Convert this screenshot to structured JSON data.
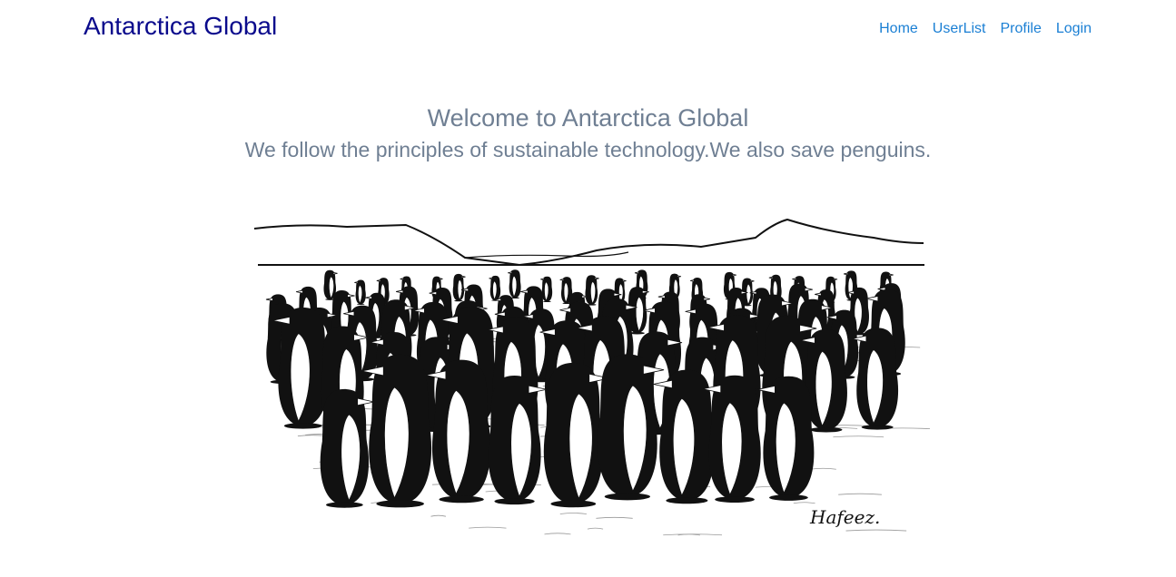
{
  "navbar": {
    "brand": "Antarctica Global",
    "links": [
      {
        "label": "Home"
      },
      {
        "label": "UserList"
      },
      {
        "label": "Profile"
      },
      {
        "label": "Login"
      }
    ]
  },
  "hero": {
    "title": "Welcome to Antarctica Global",
    "subtitle": "We follow the principles of sustainable technology.We also save penguins."
  },
  "illustration": {
    "subject": "penguin-crowd-cartoon",
    "signature": "Hafeez."
  },
  "colors": {
    "brand": "#0a0a8c",
    "link": "#1a7fd4",
    "hero_text": "#6f7f93"
  }
}
